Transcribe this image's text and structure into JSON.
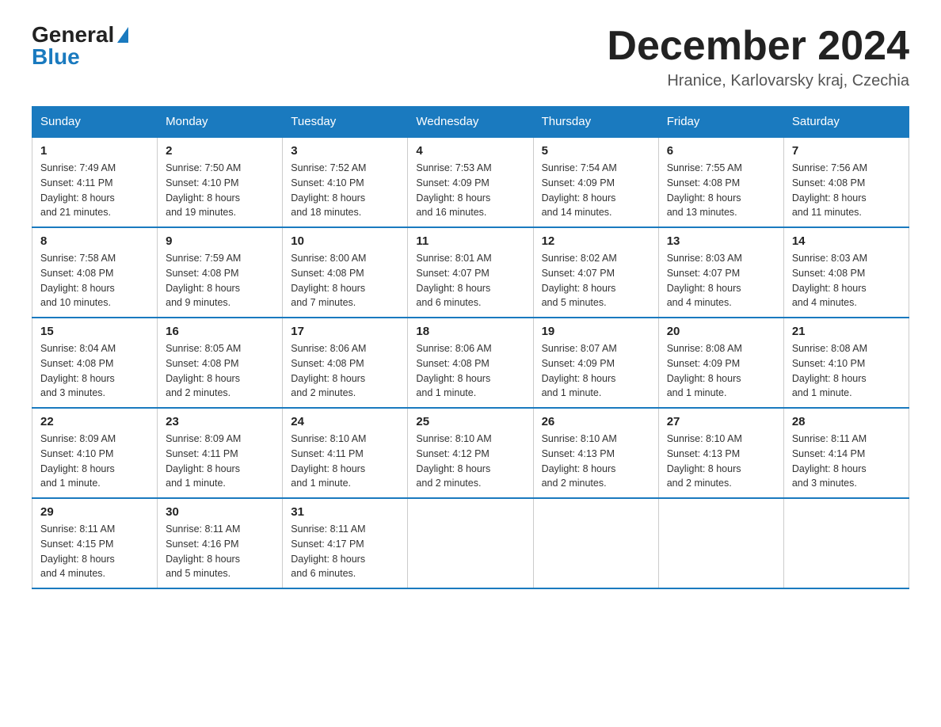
{
  "header": {
    "logo_general": "General",
    "logo_blue": "Blue",
    "title": "December 2024",
    "subtitle": "Hranice, Karlovarsky kraj, Czechia"
  },
  "weekdays": [
    "Sunday",
    "Monday",
    "Tuesday",
    "Wednesday",
    "Thursday",
    "Friday",
    "Saturday"
  ],
  "weeks": [
    [
      {
        "day": "1",
        "sunrise": "7:49 AM",
        "sunset": "4:11 PM",
        "daylight": "8 hours and 21 minutes."
      },
      {
        "day": "2",
        "sunrise": "7:50 AM",
        "sunset": "4:10 PM",
        "daylight": "8 hours and 19 minutes."
      },
      {
        "day": "3",
        "sunrise": "7:52 AM",
        "sunset": "4:10 PM",
        "daylight": "8 hours and 18 minutes."
      },
      {
        "day": "4",
        "sunrise": "7:53 AM",
        "sunset": "4:09 PM",
        "daylight": "8 hours and 16 minutes."
      },
      {
        "day": "5",
        "sunrise": "7:54 AM",
        "sunset": "4:09 PM",
        "daylight": "8 hours and 14 minutes."
      },
      {
        "day": "6",
        "sunrise": "7:55 AM",
        "sunset": "4:08 PM",
        "daylight": "8 hours and 13 minutes."
      },
      {
        "day": "7",
        "sunrise": "7:56 AM",
        "sunset": "4:08 PM",
        "daylight": "8 hours and 11 minutes."
      }
    ],
    [
      {
        "day": "8",
        "sunrise": "7:58 AM",
        "sunset": "4:08 PM",
        "daylight": "8 hours and 10 minutes."
      },
      {
        "day": "9",
        "sunrise": "7:59 AM",
        "sunset": "4:08 PM",
        "daylight": "8 hours and 9 minutes."
      },
      {
        "day": "10",
        "sunrise": "8:00 AM",
        "sunset": "4:08 PM",
        "daylight": "8 hours and 7 minutes."
      },
      {
        "day": "11",
        "sunrise": "8:01 AM",
        "sunset": "4:07 PM",
        "daylight": "8 hours and 6 minutes."
      },
      {
        "day": "12",
        "sunrise": "8:02 AM",
        "sunset": "4:07 PM",
        "daylight": "8 hours and 5 minutes."
      },
      {
        "day": "13",
        "sunrise": "8:03 AM",
        "sunset": "4:07 PM",
        "daylight": "8 hours and 4 minutes."
      },
      {
        "day": "14",
        "sunrise": "8:03 AM",
        "sunset": "4:08 PM",
        "daylight": "8 hours and 4 minutes."
      }
    ],
    [
      {
        "day": "15",
        "sunrise": "8:04 AM",
        "sunset": "4:08 PM",
        "daylight": "8 hours and 3 minutes."
      },
      {
        "day": "16",
        "sunrise": "8:05 AM",
        "sunset": "4:08 PM",
        "daylight": "8 hours and 2 minutes."
      },
      {
        "day": "17",
        "sunrise": "8:06 AM",
        "sunset": "4:08 PM",
        "daylight": "8 hours and 2 minutes."
      },
      {
        "day": "18",
        "sunrise": "8:06 AM",
        "sunset": "4:08 PM",
        "daylight": "8 hours and 1 minute."
      },
      {
        "day": "19",
        "sunrise": "8:07 AM",
        "sunset": "4:09 PM",
        "daylight": "8 hours and 1 minute."
      },
      {
        "day": "20",
        "sunrise": "8:08 AM",
        "sunset": "4:09 PM",
        "daylight": "8 hours and 1 minute."
      },
      {
        "day": "21",
        "sunrise": "8:08 AM",
        "sunset": "4:10 PM",
        "daylight": "8 hours and 1 minute."
      }
    ],
    [
      {
        "day": "22",
        "sunrise": "8:09 AM",
        "sunset": "4:10 PM",
        "daylight": "8 hours and 1 minute."
      },
      {
        "day": "23",
        "sunrise": "8:09 AM",
        "sunset": "4:11 PM",
        "daylight": "8 hours and 1 minute."
      },
      {
        "day": "24",
        "sunrise": "8:10 AM",
        "sunset": "4:11 PM",
        "daylight": "8 hours and 1 minute."
      },
      {
        "day": "25",
        "sunrise": "8:10 AM",
        "sunset": "4:12 PM",
        "daylight": "8 hours and 2 minutes."
      },
      {
        "day": "26",
        "sunrise": "8:10 AM",
        "sunset": "4:13 PM",
        "daylight": "8 hours and 2 minutes."
      },
      {
        "day": "27",
        "sunrise": "8:10 AM",
        "sunset": "4:13 PM",
        "daylight": "8 hours and 2 minutes."
      },
      {
        "day": "28",
        "sunrise": "8:11 AM",
        "sunset": "4:14 PM",
        "daylight": "8 hours and 3 minutes."
      }
    ],
    [
      {
        "day": "29",
        "sunrise": "8:11 AM",
        "sunset": "4:15 PM",
        "daylight": "8 hours and 4 minutes."
      },
      {
        "day": "30",
        "sunrise": "8:11 AM",
        "sunset": "4:16 PM",
        "daylight": "8 hours and 5 minutes."
      },
      {
        "day": "31",
        "sunrise": "8:11 AM",
        "sunset": "4:17 PM",
        "daylight": "8 hours and 6 minutes."
      },
      null,
      null,
      null,
      null
    ]
  ],
  "labels": {
    "sunrise": "Sunrise:",
    "sunset": "Sunset:",
    "daylight": "Daylight:"
  }
}
